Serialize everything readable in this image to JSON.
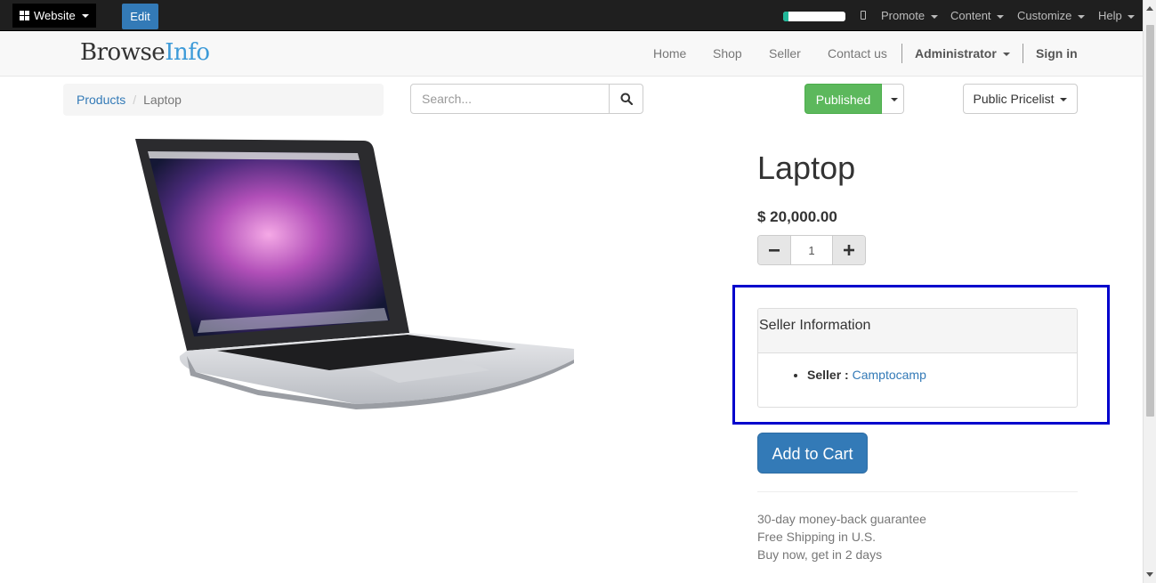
{
  "admin_bar": {
    "website_label": "Website",
    "edit_label": "Edit",
    "progress_fraction": 0.08,
    "menus": [
      "Promote",
      "Content",
      "Customize",
      "Help"
    ]
  },
  "navbar": {
    "logo_main": "Browse",
    "logo_accent": "Info",
    "links": [
      "Home",
      "Shop",
      "Seller",
      "Contact us"
    ],
    "user": "Administrator",
    "sign_in": "Sign in"
  },
  "breadcrumb": {
    "parent": "Products",
    "current": "Laptop"
  },
  "search": {
    "placeholder": "Search..."
  },
  "publish": {
    "label": "Published"
  },
  "pricelist": {
    "label": "Public Pricelist"
  },
  "product": {
    "name": "Laptop",
    "price": "$ 20,000.00",
    "quantity": "1",
    "add_to_cart": "Add to Cart",
    "guarantees": [
      "30-day money-back guarantee",
      "Free Shipping in U.S.",
      "Buy now, get in 2 days"
    ]
  },
  "seller_panel": {
    "heading": "Seller Information",
    "seller_label": "Seller :",
    "seller_name": "Camptocamp"
  },
  "colors": {
    "highlight_border": "#0000cc",
    "published_green": "#5cb85c",
    "primary_blue": "#337ab7"
  }
}
